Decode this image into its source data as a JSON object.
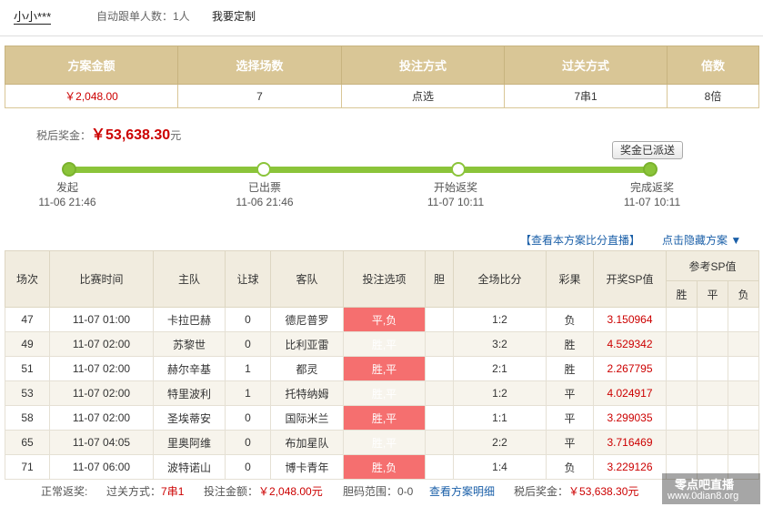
{
  "topbar": {
    "user": "小小***",
    "follow_count": "自动跟单人数：1人",
    "custom": "我要定制"
  },
  "summary": {
    "headers": [
      "方案金额",
      "选择场数",
      "投注方式",
      "过关方式",
      "倍数"
    ],
    "values": [
      "￥2,048.00",
      "7",
      "点选",
      "7串1",
      "8倍"
    ]
  },
  "prize": {
    "label": "税后奖金：",
    "amount": "￥53,638.30",
    "unit": "元"
  },
  "dispatch_label": "奖金已派送",
  "stages": [
    {
      "name": "发起",
      "time": "11-06 21:46"
    },
    {
      "name": "已出票",
      "time": "11-06 21:46"
    },
    {
      "name": "开始返奖",
      "time": "11-07 10:11"
    },
    {
      "name": "完成返奖",
      "time": "11-07 10:11"
    }
  ],
  "links": {
    "live": "【查看本方案比分直播】",
    "hide": "点击隐藏方案 ▼"
  },
  "table": {
    "headers": [
      "场次",
      "比赛时间",
      "主队",
      "让球",
      "客队",
      "投注选项",
      "胆",
      "全场比分",
      "彩果",
      "开奖SP值",
      "参考SP值"
    ],
    "sp_sub": [
      "胜",
      "平",
      "负"
    ],
    "rows": [
      [
        "47",
        "11-07 01:00",
        "卡拉巴赫",
        "0",
        "德尼普罗",
        "平,负",
        "",
        "1:2",
        "负",
        "3.150964"
      ],
      [
        "49",
        "11-07 02:00",
        "苏黎世",
        "0",
        "比利亚雷",
        "胜,平",
        "",
        "3:2",
        "胜",
        "4.529342"
      ],
      [
        "51",
        "11-07 02:00",
        "赫尔辛基",
        "1",
        "都灵",
        "胜,平",
        "",
        "2:1",
        "胜",
        "2.267795"
      ],
      [
        "53",
        "11-07 02:00",
        "特里波利",
        "1",
        "托特纳姆",
        "胜,平",
        "",
        "1:2",
        "平",
        "4.024917"
      ],
      [
        "58",
        "11-07 02:00",
        "圣埃蒂安",
        "0",
        "国际米兰",
        "胜,平",
        "",
        "1:1",
        "平",
        "3.299035"
      ],
      [
        "65",
        "11-07 04:05",
        "里奥阿维",
        "0",
        "布加星队",
        "胜,平",
        "",
        "2:2",
        "平",
        "3.716469"
      ],
      [
        "71",
        "11-07 06:00",
        "波特诺山",
        "0",
        "博卡青年",
        "胜,负",
        "",
        "1:4",
        "负",
        "3.229126"
      ]
    ]
  },
  "footer": {
    "status": "正常返奖:",
    "pass_label": "过关方式：",
    "pass_value": "7串1",
    "bet_label": "投注金额：",
    "bet_value": "￥2,048.00元",
    "range_label": "胆码范围：",
    "range_value": "0-0",
    "detail_link": "查看方案明细",
    "prize_label": "税后奖金：",
    "prize_value": "￥53,638.30元"
  },
  "watermark": {
    "line1": "零点吧直播",
    "line2": "www.0dian8.org"
  }
}
